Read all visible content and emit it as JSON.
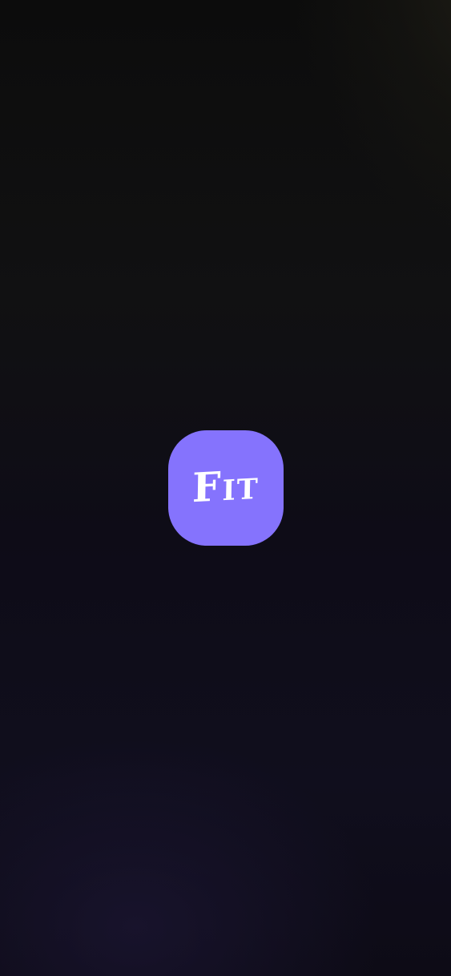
{
  "splash": {
    "logo_text": "Fit",
    "logo_color": "#8573fd",
    "logo_text_color": "#ffffff"
  }
}
